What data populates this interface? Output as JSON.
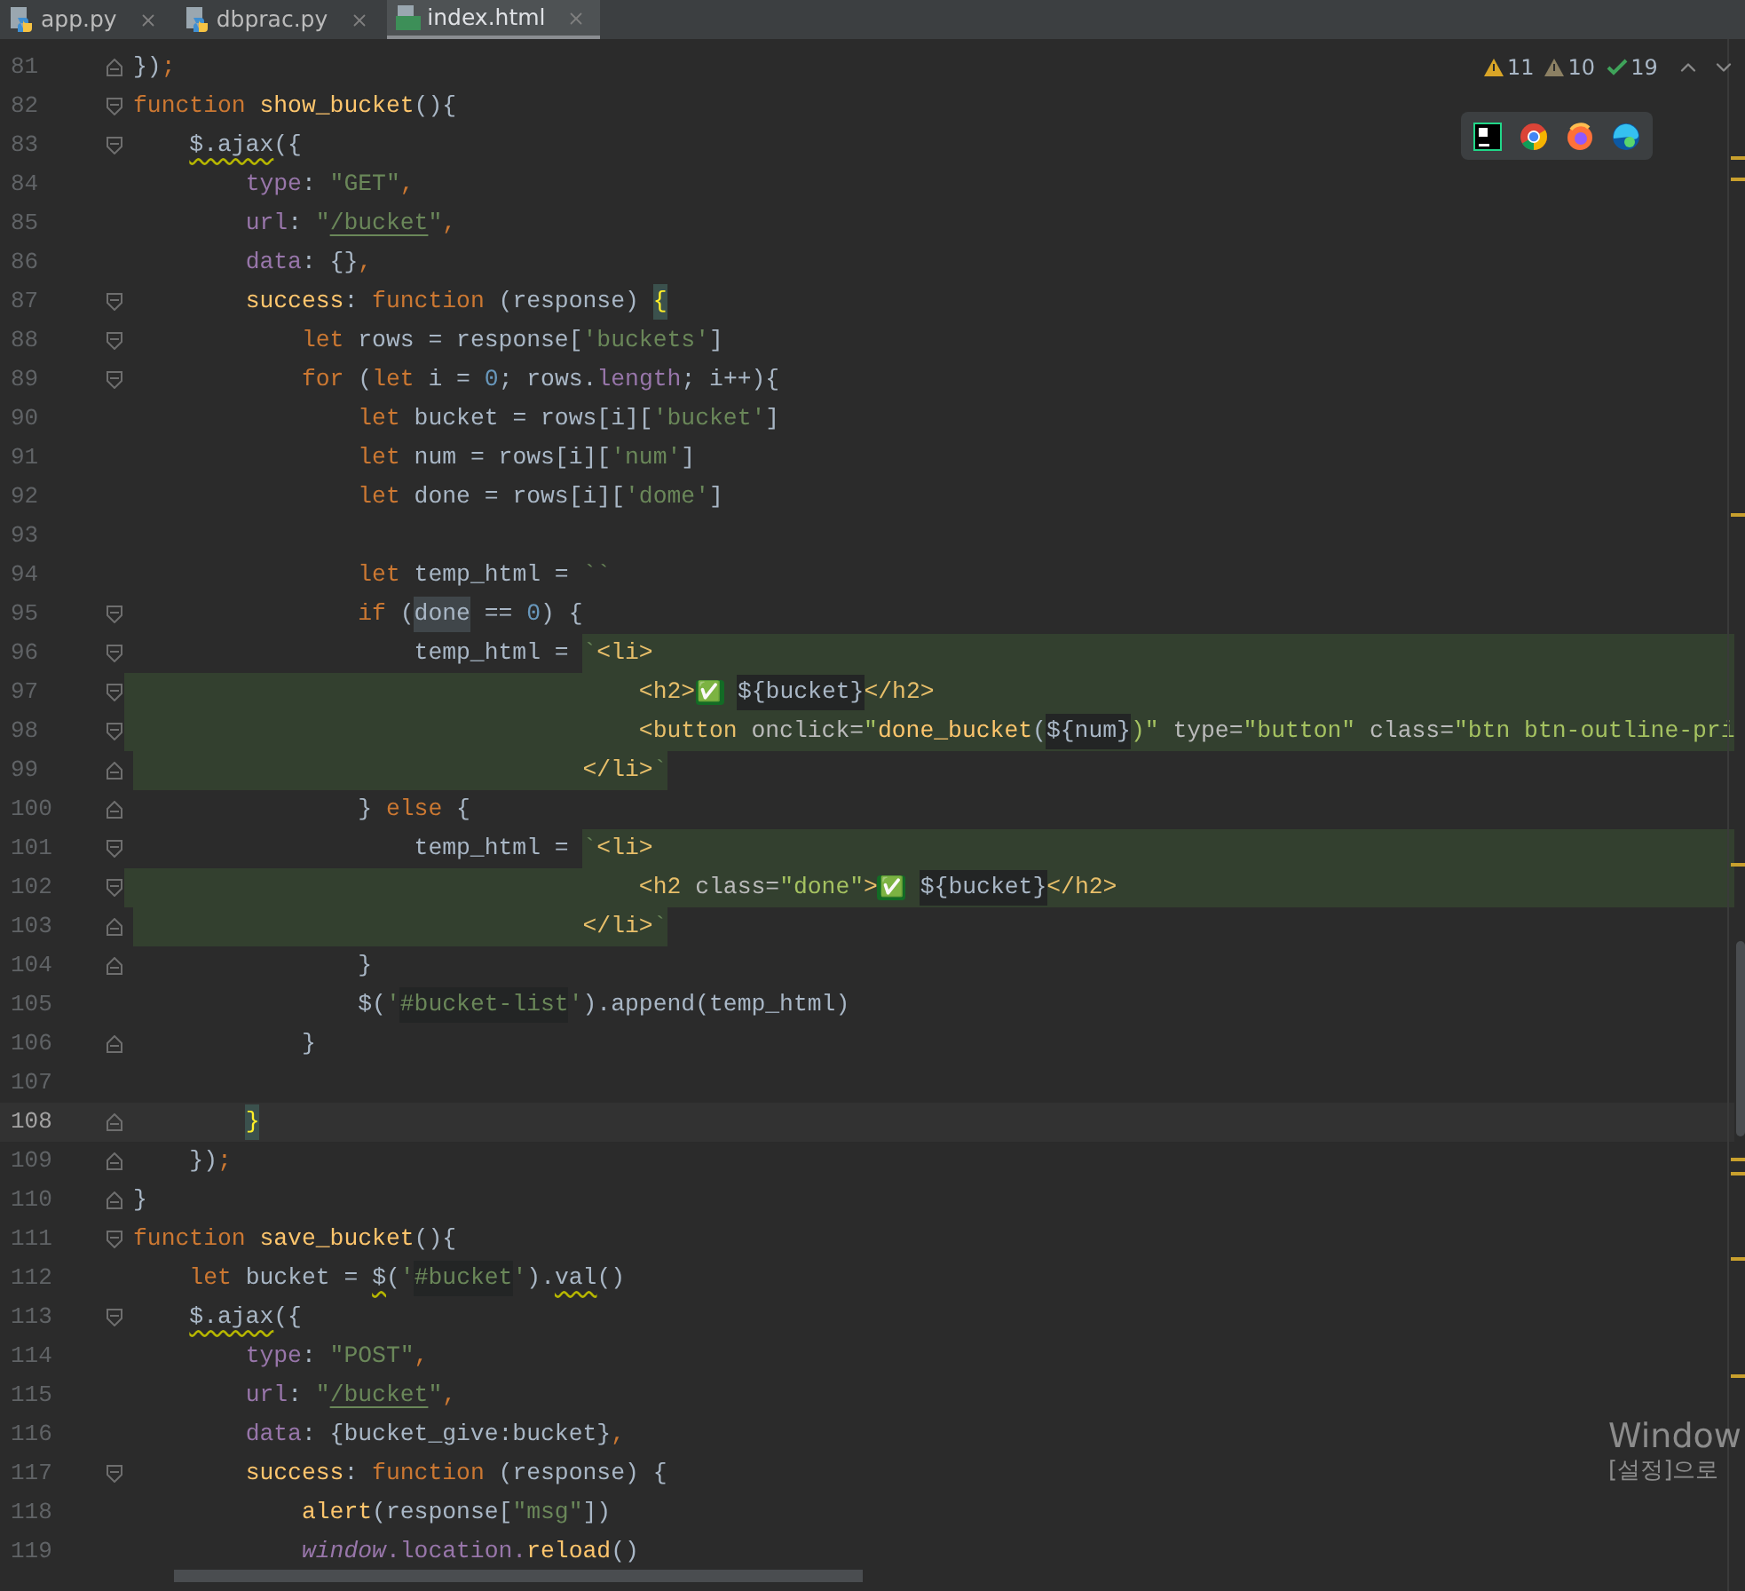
{
  "tabs": [
    {
      "label": "app.py",
      "kind": "python",
      "selected": false
    },
    {
      "label": "dbprac.py",
      "kind": "python",
      "selected": false
    },
    {
      "label": "index.html",
      "kind": "html",
      "selected": true
    }
  ],
  "inspections": [
    {
      "kind": "warning",
      "count": "11"
    },
    {
      "kind": "weak_warning",
      "count": "10"
    },
    {
      "kind": "typo",
      "count": "19"
    }
  ],
  "browsers": [
    {
      "kind": "pycharm"
    },
    {
      "kind": "chrome"
    },
    {
      "kind": "firefox"
    },
    {
      "kind": "edge"
    }
  ],
  "lines": [
    {
      "number": "81",
      "fold_end": true,
      "tokens": [
        {
          "text": "})",
          "kind": "plain"
        },
        {
          "text": ";",
          "kind": "keyword"
        }
      ]
    },
    {
      "number": "82",
      "fold_start": true,
      "tokens": [
        {
          "text": "function",
          "kind": "keyword"
        },
        {
          "text": " show_bucket",
          "kind": "fname"
        },
        {
          "text": "(){",
          "kind": "plain"
        }
      ]
    },
    {
      "number": "83",
      "fold_start": true,
      "tokens": [
        {
          "text": "    $.ajax",
          "kind": "plain",
          "wavy": true
        },
        {
          "text": "({",
          "kind": "plain"
        }
      ]
    },
    {
      "number": "84",
      "tokens": [
        {
          "text": "        type",
          "kind": "prop"
        },
        {
          "text": ": ",
          "kind": "plain"
        },
        {
          "text": "\"GET\"",
          "kind": "string"
        },
        {
          "text": ",",
          "kind": "keyword"
        }
      ]
    },
    {
      "number": "85",
      "tokens": [
        {
          "text": "        url",
          "kind": "prop"
        },
        {
          "text": ": ",
          "kind": "plain"
        },
        {
          "text": "\"",
          "kind": "string"
        },
        {
          "text": "/bucket",
          "kind": "string",
          "link": true
        },
        {
          "text": "\"",
          "kind": "string"
        },
        {
          "text": ",",
          "kind": "keyword"
        }
      ]
    },
    {
      "number": "86",
      "tokens": [
        {
          "text": "        data",
          "kind": "prop"
        },
        {
          "text": ": {}",
          "kind": "plain"
        },
        {
          "text": ",",
          "kind": "keyword"
        }
      ]
    },
    {
      "number": "87",
      "fold_start": true,
      "tokens": [
        {
          "text": "        success",
          "kind": "fname"
        },
        {
          "text": ": ",
          "kind": "plain"
        },
        {
          "text": "function",
          "kind": "keyword"
        },
        {
          "text": " (response) ",
          "kind": "plain"
        },
        {
          "text": "{",
          "kind": "plain",
          "brace_match": true
        }
      ]
    },
    {
      "number": "88",
      "fold_start": true,
      "tokens": [
        {
          "text": "            let",
          "kind": "keyword"
        },
        {
          "text": " rows = response[",
          "kind": "plain"
        },
        {
          "text": "'buckets'",
          "kind": "string"
        },
        {
          "text": "]",
          "kind": "plain"
        }
      ]
    },
    {
      "number": "89",
      "fold_start": true,
      "tokens": [
        {
          "text": "            for",
          "kind": "keyword"
        },
        {
          "text": " (",
          "kind": "plain"
        },
        {
          "text": "let",
          "kind": "keyword"
        },
        {
          "text": " i = ",
          "kind": "plain"
        },
        {
          "text": "0",
          "kind": "number"
        },
        {
          "text": "; rows.",
          "kind": "plain"
        },
        {
          "text": "length",
          "kind": "prop"
        },
        {
          "text": "; i++){",
          "kind": "plain"
        }
      ]
    },
    {
      "number": "90",
      "tokens": [
        {
          "text": "                let",
          "kind": "keyword"
        },
        {
          "text": " bucket = rows[i][",
          "kind": "plain"
        },
        {
          "text": "'bucket'",
          "kind": "string"
        },
        {
          "text": "]",
          "kind": "plain"
        }
      ]
    },
    {
      "number": "91",
      "tokens": [
        {
          "text": "                let",
          "kind": "keyword"
        },
        {
          "text": " num = rows[i][",
          "kind": "plain"
        },
        {
          "text": "'num'",
          "kind": "string"
        },
        {
          "text": "]",
          "kind": "plain"
        }
      ]
    },
    {
      "number": "92",
      "tokens": [
        {
          "text": "                let",
          "kind": "keyword"
        },
        {
          "text": " done = rows[i][",
          "kind": "plain"
        },
        {
          "text": "'dome'",
          "kind": "string"
        },
        {
          "text": "]",
          "kind": "plain"
        }
      ]
    },
    {
      "number": "93"
    },
    {
      "number": "94",
      "tokens": [
        {
          "text": "                let",
          "kind": "keyword"
        },
        {
          "text": " temp_html = ",
          "kind": "plain"
        },
        {
          "text": "``",
          "kind": "string"
        }
      ]
    },
    {
      "number": "95",
      "fold_start": true,
      "tokens": [
        {
          "text": "                if",
          "kind": "keyword"
        },
        {
          "text": " (",
          "kind": "plain"
        },
        {
          "text": "done",
          "kind": "plain",
          "usage": true
        },
        {
          "text": " == ",
          "kind": "plain"
        },
        {
          "text": "0",
          "kind": "number"
        },
        {
          "text": ") {",
          "kind": "plain"
        }
      ]
    },
    {
      "number": "96",
      "fold_start": true,
      "tokens": [
        {
          "text": "                    temp_html = ",
          "kind": "plain"
        },
        {
          "text": "`",
          "kind": "string",
          "injected": true
        },
        {
          "text": "<li>",
          "kind": "tag",
          "injected": true
        }
      ]
    },
    {
      "number": "97",
      "fold_start": true,
      "injected": true,
      "tokens": [
        {
          "text": "                                    <h2>",
          "kind": "tag"
        },
        {
          "text": "✅",
          "kind": "emoji"
        },
        {
          "text": " ${bucket}",
          "kind": "plain",
          "embedded": true
        },
        {
          "text": "</h2>",
          "kind": "tag"
        }
      ]
    },
    {
      "number": "98",
      "fold_start": true,
      "injected": true,
      "tokens": [
        {
          "text": "                                    <button",
          "kind": "tag"
        },
        {
          "text": " onclick=",
          "kind": "attr"
        },
        {
          "text": "\"",
          "kind": "attrvalue"
        },
        {
          "text": "done_bucket",
          "kind": "fname"
        },
        {
          "text": "(",
          "kind": "plain"
        },
        {
          "text": "${num}",
          "kind": "plain",
          "embedded": true
        },
        {
          "text": ")\"",
          "kind": "attrvalue"
        },
        {
          "text": " type=",
          "kind": "attr"
        },
        {
          "text": "\"button\"",
          "kind": "attrvalue"
        },
        {
          "text": " class=",
          "kind": "attr"
        },
        {
          "text": "\"btn btn-outline-pri",
          "kind": "attrvalue"
        }
      ]
    },
    {
      "number": "99",
      "fold_end": true,
      "tokens": [
        {
          "text": "                                </li>",
          "kind": "tag",
          "injected": true
        },
        {
          "text": "`",
          "kind": "string",
          "injected": true
        }
      ]
    },
    {
      "number": "100",
      "fold_end": true,
      "tokens": [
        {
          "text": "                } ",
          "kind": "plain"
        },
        {
          "text": "else",
          "kind": "keyword"
        },
        {
          "text": " {",
          "kind": "plain"
        }
      ]
    },
    {
      "number": "101",
      "fold_start": true,
      "tokens": [
        {
          "text": "                    temp_html = ",
          "kind": "plain"
        },
        {
          "text": "`",
          "kind": "string",
          "injected": true
        },
        {
          "text": "<li>",
          "kind": "tag",
          "injected": true
        }
      ]
    },
    {
      "number": "102",
      "fold_start": true,
      "injected": true,
      "tokens": [
        {
          "text": "                                    <h2",
          "kind": "tag"
        },
        {
          "text": " class=",
          "kind": "attr"
        },
        {
          "text": "\"done\"",
          "kind": "attrvalue"
        },
        {
          "text": ">",
          "kind": "tag"
        },
        {
          "text": "✅",
          "kind": "emoji"
        },
        {
          "text": " ${bucket}",
          "kind": "plain",
          "embedded": true
        },
        {
          "text": "</h2>",
          "kind": "tag"
        }
      ]
    },
    {
      "number": "103",
      "fold_end": true,
      "tokens": [
        {
          "text": "                                </li>",
          "kind": "tag",
          "injected": true
        },
        {
          "text": "`",
          "kind": "string",
          "injected": true
        }
      ]
    },
    {
      "number": "104",
      "fold_end": true,
      "tokens": [
        {
          "text": "                }",
          "kind": "plain"
        }
      ]
    },
    {
      "number": "105",
      "tokens": [
        {
          "text": "                $(",
          "kind": "plain"
        },
        {
          "text": "'",
          "kind": "string"
        },
        {
          "text": "#bucket-list",
          "kind": "string",
          "embedded": true
        },
        {
          "text": "'",
          "kind": "string"
        },
        {
          "text": ").append(temp_html)",
          "kind": "plain"
        }
      ]
    },
    {
      "number": "106",
      "fold_end": true,
      "tokens": [
        {
          "text": "            }",
          "kind": "plain"
        }
      ]
    },
    {
      "number": "107"
    },
    {
      "number": "108",
      "fold_end": true,
      "current": true,
      "tokens": [
        {
          "text": "        }",
          "kind": "plain",
          "brace_match": true
        }
      ]
    },
    {
      "number": "109",
      "fold_end": true,
      "tokens": [
        {
          "text": "    })",
          "kind": "plain"
        },
        {
          "text": ";",
          "kind": "keyword"
        }
      ]
    },
    {
      "number": "110",
      "fold_end": true,
      "tokens": [
        {
          "text": "}",
          "kind": "plain"
        }
      ]
    },
    {
      "number": "111",
      "fold_start": true,
      "tokens": [
        {
          "text": "function",
          "kind": "keyword"
        },
        {
          "text": " save_bucket",
          "kind": "fname"
        },
        {
          "text": "(){",
          "kind": "plain"
        }
      ]
    },
    {
      "number": "112",
      "tokens": [
        {
          "text": "    let",
          "kind": "keyword"
        },
        {
          "text": " bucket = ",
          "kind": "plain"
        },
        {
          "text": "$",
          "kind": "plain",
          "wavy": true
        },
        {
          "text": "(",
          "kind": "plain"
        },
        {
          "text": "'",
          "kind": "string"
        },
        {
          "text": "#bucket",
          "kind": "string",
          "embedded": true
        },
        {
          "text": "'",
          "kind": "string"
        },
        {
          "text": ").",
          "kind": "plain"
        },
        {
          "text": "val",
          "kind": "plain",
          "wavy": true
        },
        {
          "text": "()",
          "kind": "plain"
        }
      ]
    },
    {
      "number": "113",
      "fold_start": true,
      "tokens": [
        {
          "text": "    $.ajax",
          "kind": "plain",
          "wavy": true
        },
        {
          "text": "({",
          "kind": "plain"
        }
      ]
    },
    {
      "number": "114",
      "tokens": [
        {
          "text": "        type",
          "kind": "prop"
        },
        {
          "text": ": ",
          "kind": "plain"
        },
        {
          "text": "\"POST\"",
          "kind": "string"
        },
        {
          "text": ",",
          "kind": "keyword"
        }
      ]
    },
    {
      "number": "115",
      "tokens": [
        {
          "text": "        url",
          "kind": "prop"
        },
        {
          "text": ": ",
          "kind": "plain"
        },
        {
          "text": "\"",
          "kind": "string"
        },
        {
          "text": "/bucket",
          "kind": "string",
          "link": true
        },
        {
          "text": "\"",
          "kind": "string"
        },
        {
          "text": ",",
          "kind": "keyword"
        }
      ]
    },
    {
      "number": "116",
      "tokens": [
        {
          "text": "        data",
          "kind": "prop"
        },
        {
          "text": ": {bucket_give:bucket}",
          "kind": "plain"
        },
        {
          "text": ",",
          "kind": "keyword"
        }
      ]
    },
    {
      "number": "117",
      "fold_start": true,
      "tokens": [
        {
          "text": "        success",
          "kind": "fname"
        },
        {
          "text": ": ",
          "kind": "plain"
        },
        {
          "text": "function",
          "kind": "keyword"
        },
        {
          "text": " (response) {",
          "kind": "plain"
        }
      ]
    },
    {
      "number": "118",
      "tokens": [
        {
          "text": "            alert",
          "kind": "fname"
        },
        {
          "text": "(response[",
          "kind": "plain"
        },
        {
          "text": "\"msg\"",
          "kind": "string"
        },
        {
          "text": "])",
          "kind": "plain"
        }
      ]
    },
    {
      "number": "119",
      "tokens": [
        {
          "text": "            window",
          "kind": "global"
        },
        {
          "text": ".location.",
          "kind": "prop"
        },
        {
          "text": "reload",
          "kind": "fname"
        },
        {
          "text": "()",
          "kind": "plain"
        }
      ]
    }
  ],
  "os_notice": {
    "line_1": "Window",
    "line_2": "[설정]으로"
  }
}
